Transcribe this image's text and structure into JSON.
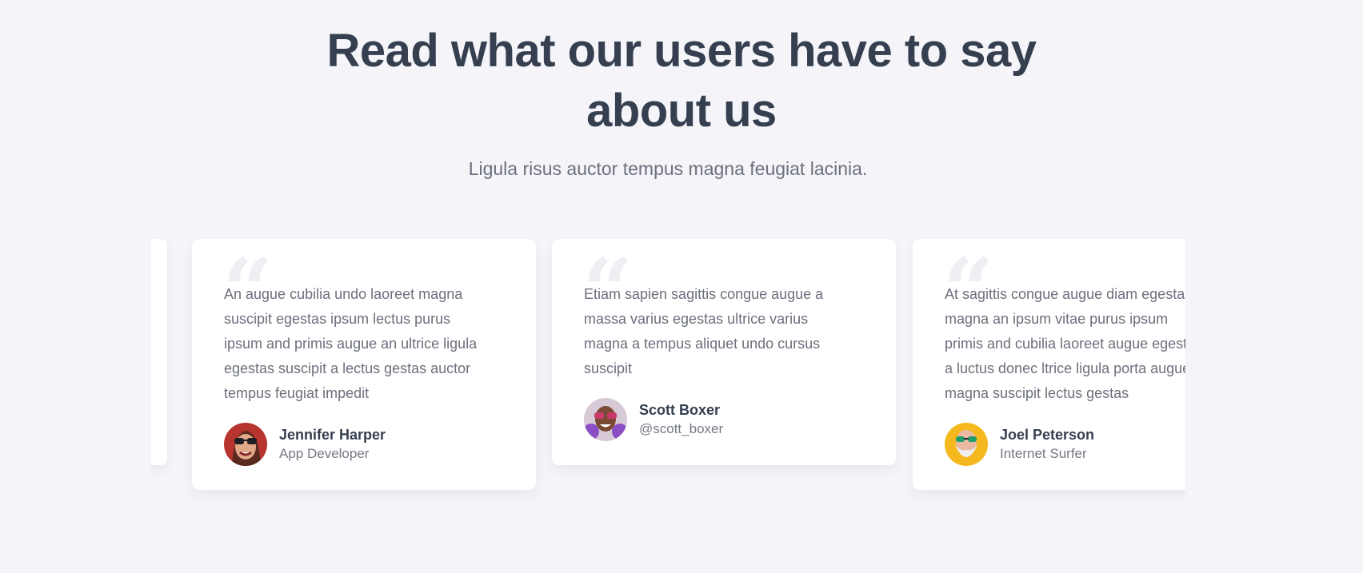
{
  "section": {
    "title": "Read what our users have to say about us",
    "title_line1": "Read what our users have to say",
    "title_line2": "about us",
    "subtitle": "Ligula risus auctor tempus magna feugiat lacinia."
  },
  "testimonials": [
    {
      "quote": "An augue cubilia undo laoreet magna suscipit egestas ipsum lectus purus ipsum and primis augue an ultrice ligula egestas suscipit a lectus gestas auctor tempus feugiat impedit",
      "lines": [
        "An augue cubilia undo laoreet magna",
        "suscipit egestas ipsum lectus purus",
        "ipsum and primis augue an ultrice ligula",
        "egestas suscipit a lectus gestas auctor",
        "tempus feugiat impedit"
      ],
      "name": "Jennifer Harper",
      "role": "App Developer",
      "avatar_icon": "woman-with-sunglasses-avatar",
      "avatar_bg": "#b7342f"
    },
    {
      "quote": "Etiam sapien sagittis congue augue a massa varius egestas ultrice varius magna a tempus aliquet undo cursus suscipit",
      "lines": [
        "Etiam sapien sagittis congue augue a",
        "massa varius egestas ultrice varius",
        "magna a tempus aliquet undo cursus",
        "suscipit"
      ],
      "name": "Scott Boxer",
      "role": "@scott_boxer",
      "avatar_icon": "man-with-purple-gloves-avatar",
      "avatar_bg": "#8a4fc4"
    },
    {
      "quote": "At sagittis congue augue diam egestas magna an ipsum vitae purus ipsum primis and cubilia laoreet augue egestas a luctus donec ltrice ligula porta augue magna suscipit lectus gestas",
      "lines": [
        "At sagittis congue augue diam egestas",
        "magna an ipsum vitae purus ipsum",
        "primis and cubilia laoreet augue egestas",
        "a luctus donec ltrice ligula porta augue",
        "magna suscipit lectus gestas"
      ],
      "name": "Joel Peterson",
      "role": "Internet Surfer",
      "avatar_icon": "bearded-man-with-green-glasses-avatar",
      "avatar_bg": "#f6b81f"
    }
  ],
  "colors": {
    "background": "#f4f4f9",
    "heading": "#353f50",
    "body_text": "#6c707c",
    "card": "#ffffff"
  }
}
